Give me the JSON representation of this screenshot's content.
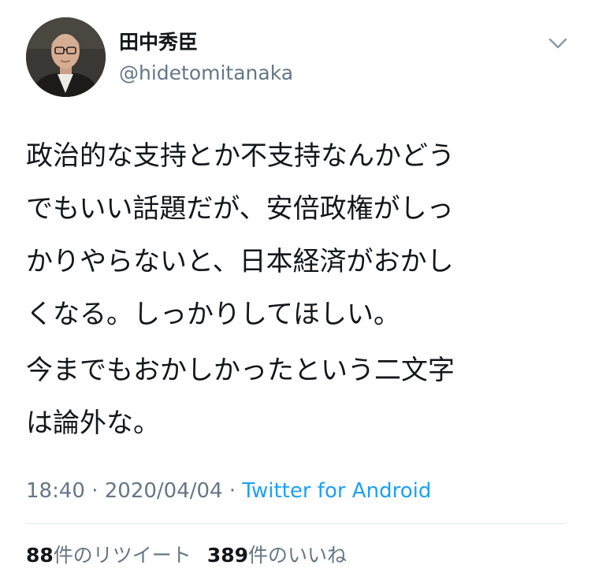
{
  "user": {
    "display_name": "田中秀臣",
    "handle": "@hidetomitanaka",
    "avatar_icon": "profile-photo"
  },
  "menu": {
    "icon": "chevron-down-icon"
  },
  "tweet": {
    "paragraph1_lines": [
      "政治的な支持とか不支持なんかどう",
      "でもいい話題だが、安倍政権がしっ",
      "かりやらないと、日本経済がおかし",
      "くなる。しっかりしてほしい。"
    ],
    "paragraph2_lines": [
      "今までもおかしかったという二文字",
      "は論外な。"
    ]
  },
  "meta": {
    "time": "18:40",
    "separator1": " · ",
    "date": "2020/04/04",
    "separator2": " · ",
    "source": "Twitter for Android"
  },
  "stats": {
    "retweet_count": "88",
    "retweet_label": "件のリツイート",
    "like_count": "389",
    "like_label": "件のいいね"
  },
  "colors": {
    "text": "#14171a",
    "secondary": "#657786",
    "link": "#1da1f2",
    "divider": "#e1e8ed"
  }
}
